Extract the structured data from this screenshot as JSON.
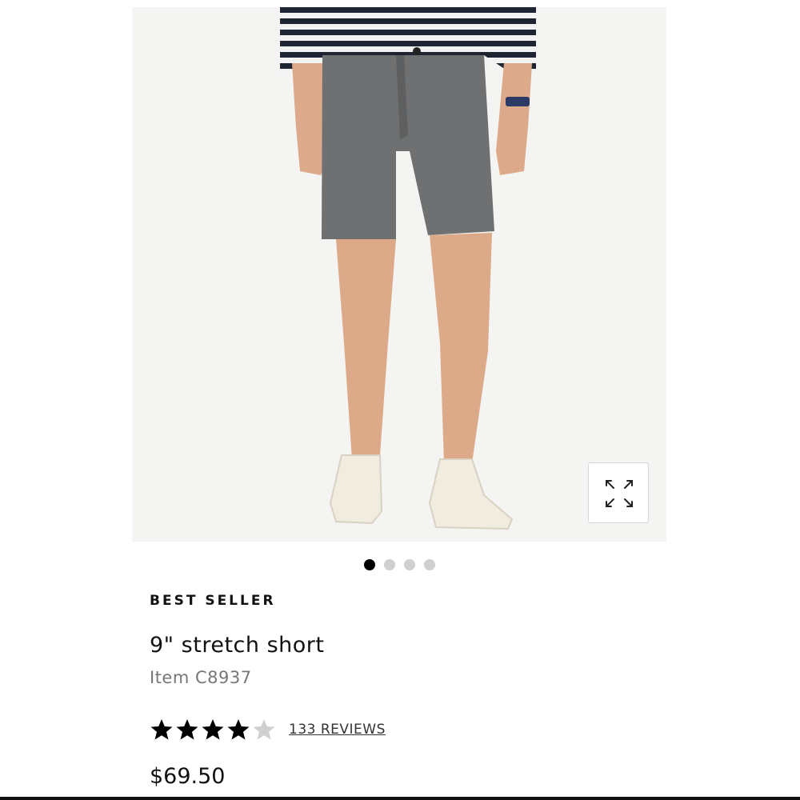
{
  "product": {
    "badge": "BEST SELLER",
    "name": "9\" stretch short",
    "item_number": "Item C8937",
    "rating": 4,
    "rating_max": 5,
    "reviews_label": "133 REVIEWS",
    "price": "$69.50"
  },
  "gallery": {
    "image_count": 4,
    "active_index": 0,
    "zoom_icon": "expand-arrows-icon"
  },
  "colors": {
    "background": "#ffffff",
    "image_bg": "#f4f4f2",
    "shorts": "#6f7071",
    "dot_active": "#000000",
    "dot_inactive": "#cfcfcf",
    "star_filled": "#000000",
    "star_empty": "#d0d0d0"
  }
}
